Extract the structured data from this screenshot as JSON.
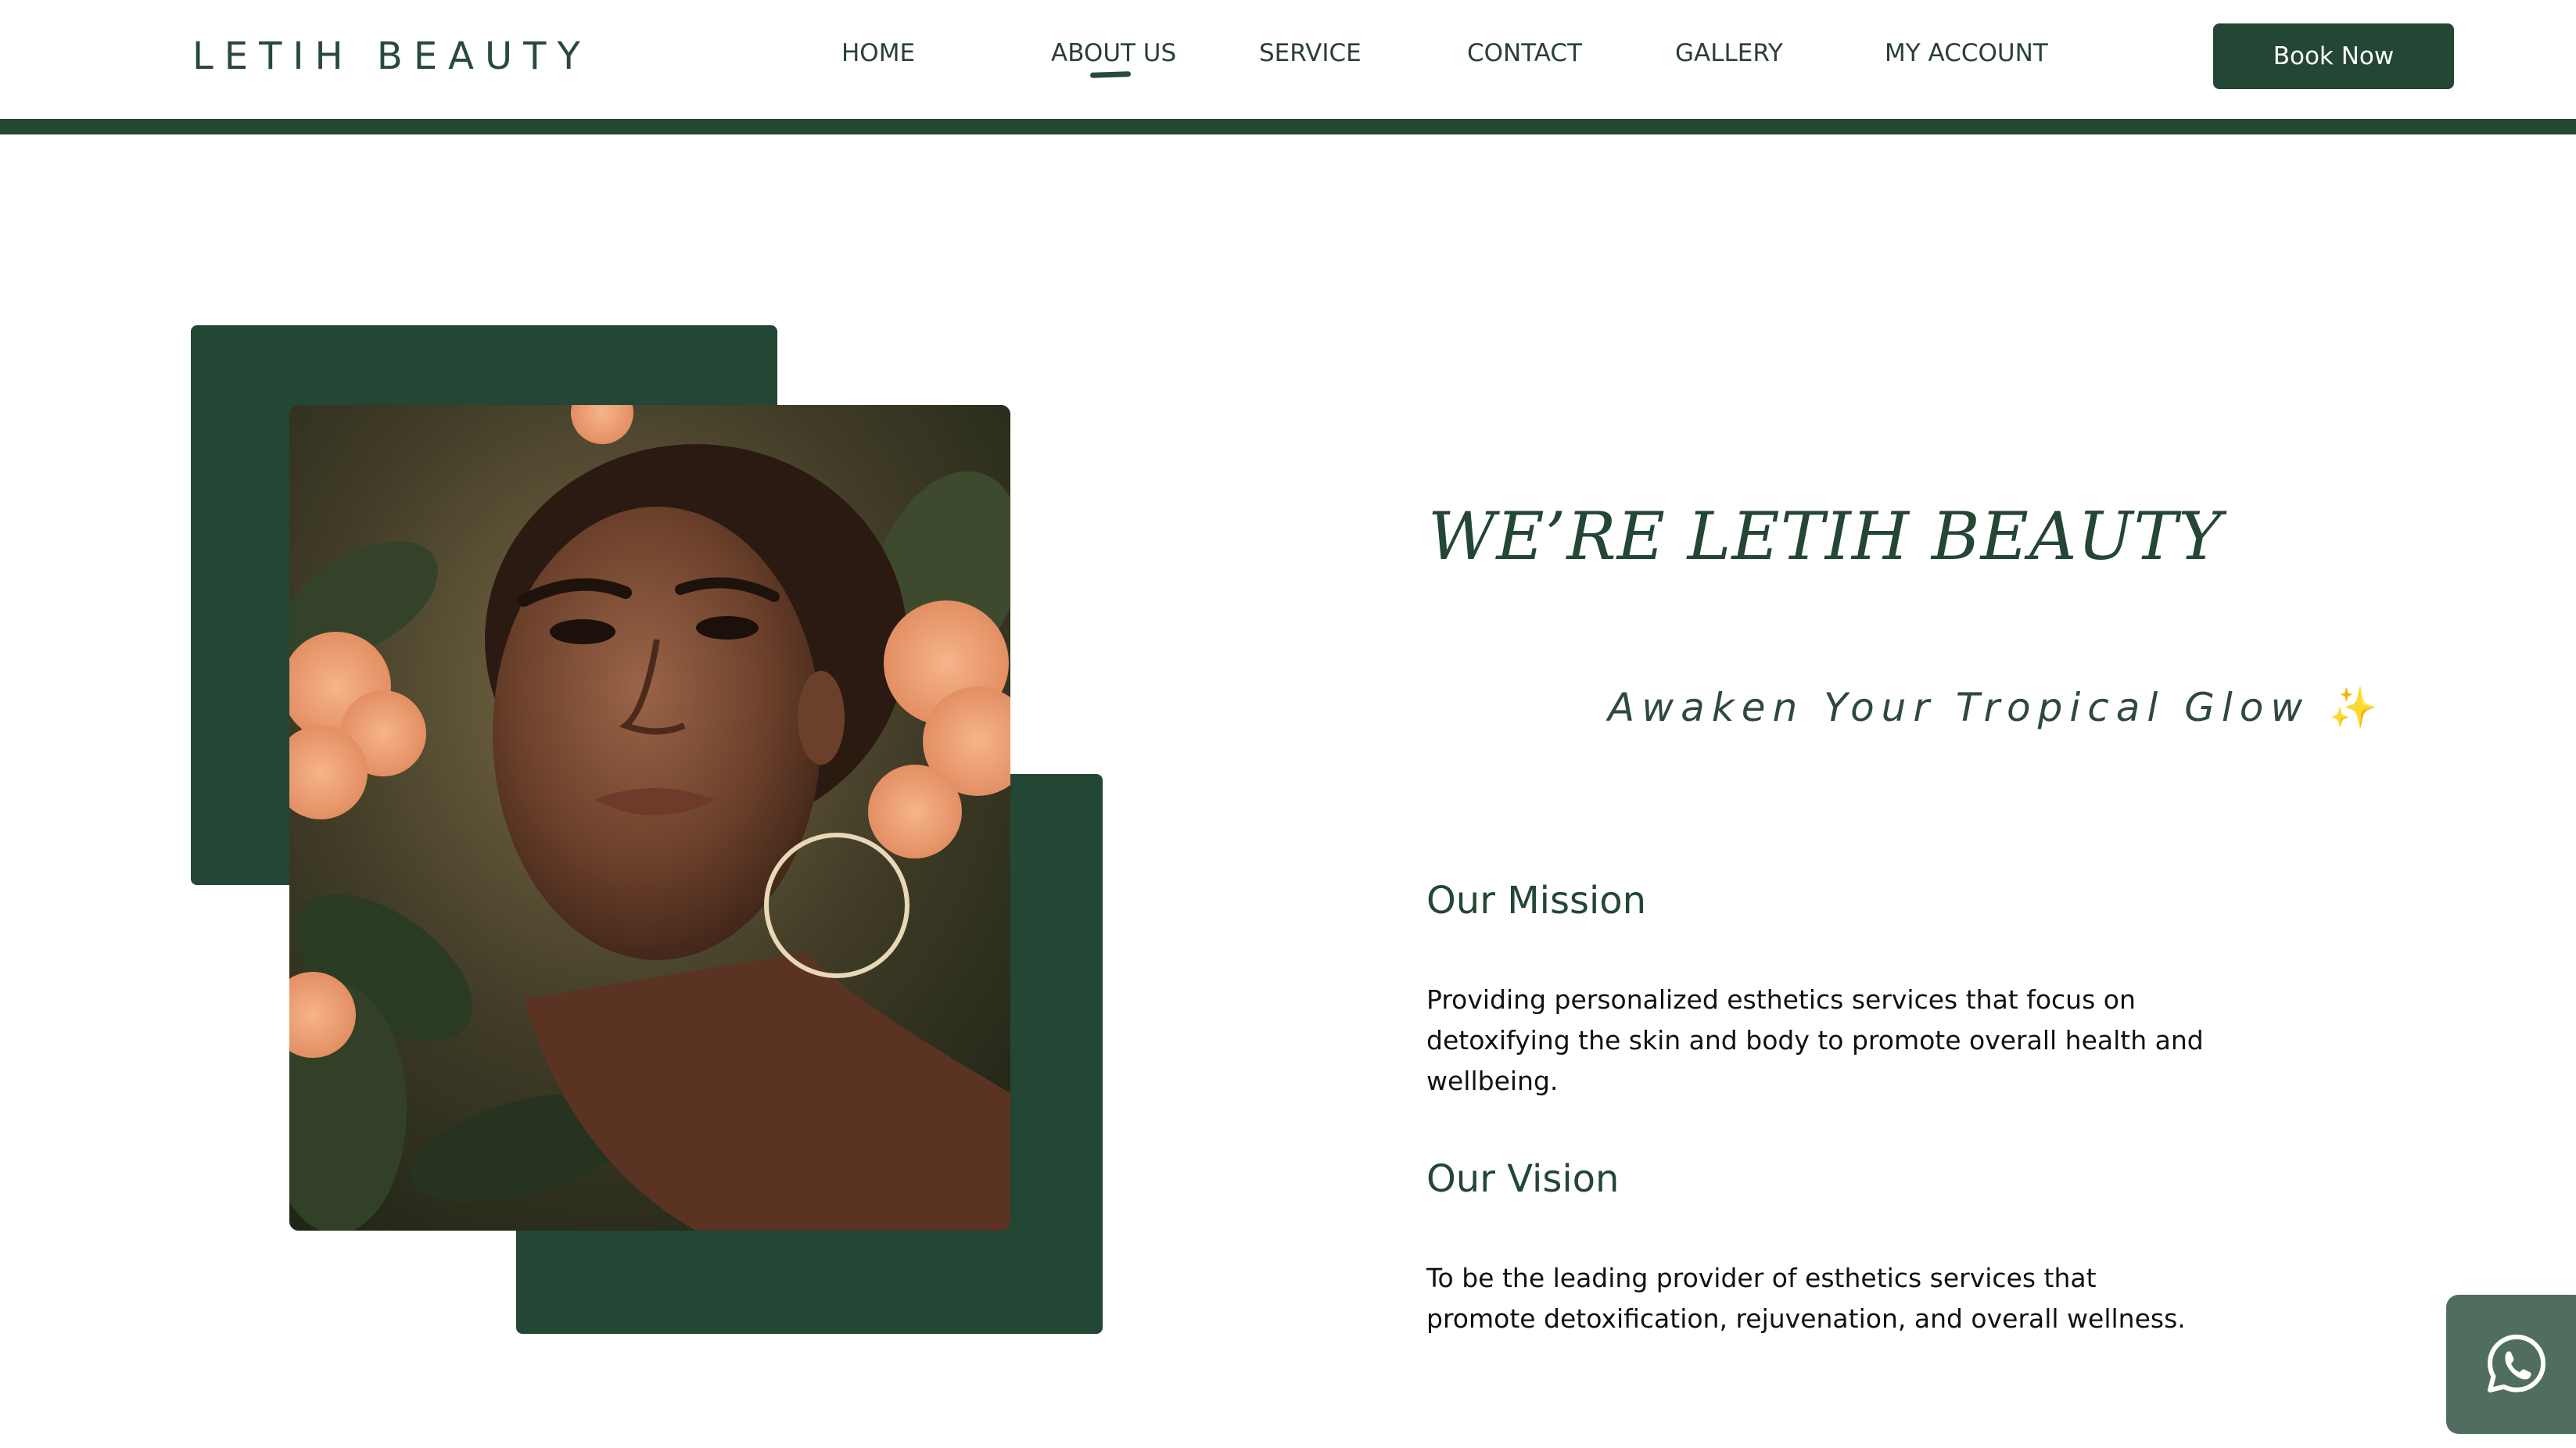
{
  "brand": {
    "logo_text": "LETIH BEAUTY",
    "primary_color": "#234635",
    "accent_sparkle_color": "#e9c46a"
  },
  "nav": {
    "items": [
      {
        "label": "HOME",
        "active": false
      },
      {
        "label": "ABOUT US",
        "active": true
      },
      {
        "label": "SERVICE",
        "active": false
      },
      {
        "label": "CONTACT",
        "active": false
      },
      {
        "label": "GALLERY",
        "active": false
      },
      {
        "label": "MY ACCOUNT",
        "active": false
      }
    ],
    "cta_label": "Book Now"
  },
  "about": {
    "headline": "WE’RE LETIH BEAUTY",
    "tagline": "Awaken Your Tropical Glow",
    "tagline_emoji": "✨",
    "mission_title": "Our Mission",
    "mission_text": "Providing personalized esthetics services that focus on detoxifying the skin and body to promote overall health and wellbeing.",
    "vision_title": "Our Vision",
    "vision_text": "To be the leading provider of esthetics services that promote detoxification, rejuvenation, and overall wellness."
  },
  "floating": {
    "icon": "whatsapp-icon"
  }
}
